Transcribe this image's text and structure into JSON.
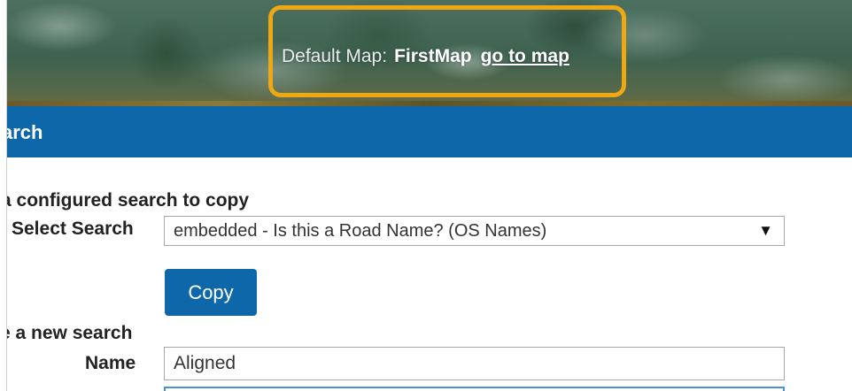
{
  "banner": {
    "default_map_label": "Default Map:",
    "default_map_name": "FirstMap",
    "go_to_map_link": "go to map",
    "highlight_color": "#f0a812"
  },
  "section": {
    "title": "arch",
    "bar_color": "#0e67a9"
  },
  "form": {
    "copy_heading": "a configured search to copy",
    "select_label": "Select Search",
    "select_value": "embedded - Is this a Road Name? (OS Names)",
    "select_arrow": "▼",
    "copy_button": "Copy",
    "new_heading": "e a new search",
    "name_label": "Name",
    "name_value": "Aligned"
  }
}
